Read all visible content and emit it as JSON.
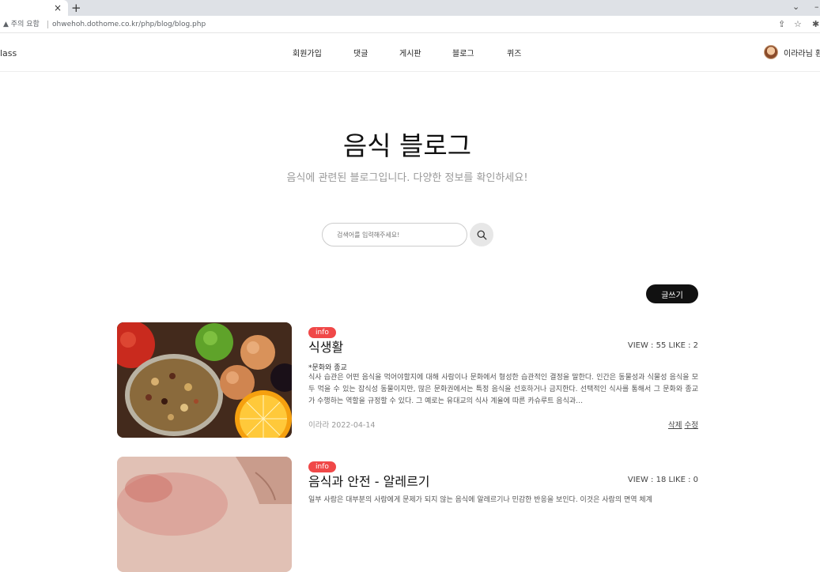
{
  "browser": {
    "tab_close": "×",
    "new_tab": "+",
    "warning": "주의 요함",
    "url": "ohwehoh.dothome.co.kr/php/blog/blog.php"
  },
  "header": {
    "logo": "lass",
    "nav": [
      "회원가입",
      "댓글",
      "게시판",
      "블로그",
      "퀴즈"
    ],
    "user_name": "이라라님 환"
  },
  "hero": {
    "title": "음식 블로그",
    "subtitle": "음식에 관련된 블로그입니다. 다양한 정보를 확인하세요!"
  },
  "search": {
    "placeholder": "검색어를 입력해주세요!"
  },
  "write_button": "글쓰기",
  "posts": [
    {
      "badge": "info",
      "title": "식생활",
      "stats": "VIEW : 55 LIKE : 2",
      "category": "*문화와 종교",
      "text": "식사 습관은 어떤 음식을 먹어야할지에 대해 사람이나 문화에서 형성한 습관적인 결정을 말한다. 인간은 동물성과 식물성 음식을 모두 먹을 수 있는 잡식성 동물이지만, 많은 문화권에서는 특정 음식을 선호하거나 금지한다. 선택적인 식사를 통해서 그 문화와 종교가 수행하는 역할을 규정할 수 있다. 그 예로는 유대교의 식사 계율에 따른 카슈루트 음식과…",
      "meta": "이라라 2022-04-14",
      "delete": "삭제",
      "edit": "수정"
    },
    {
      "badge": "info",
      "title": "음식과 안전 - 알레르기",
      "stats": "VIEW : 18 LIKE : 0",
      "text": "일부 사람은 대부분의 사람에게 문제가 되지 않는 음식에 알레르기나 민감한 반응을 보인다. 이것은 사람의 면역 체계"
    }
  ]
}
